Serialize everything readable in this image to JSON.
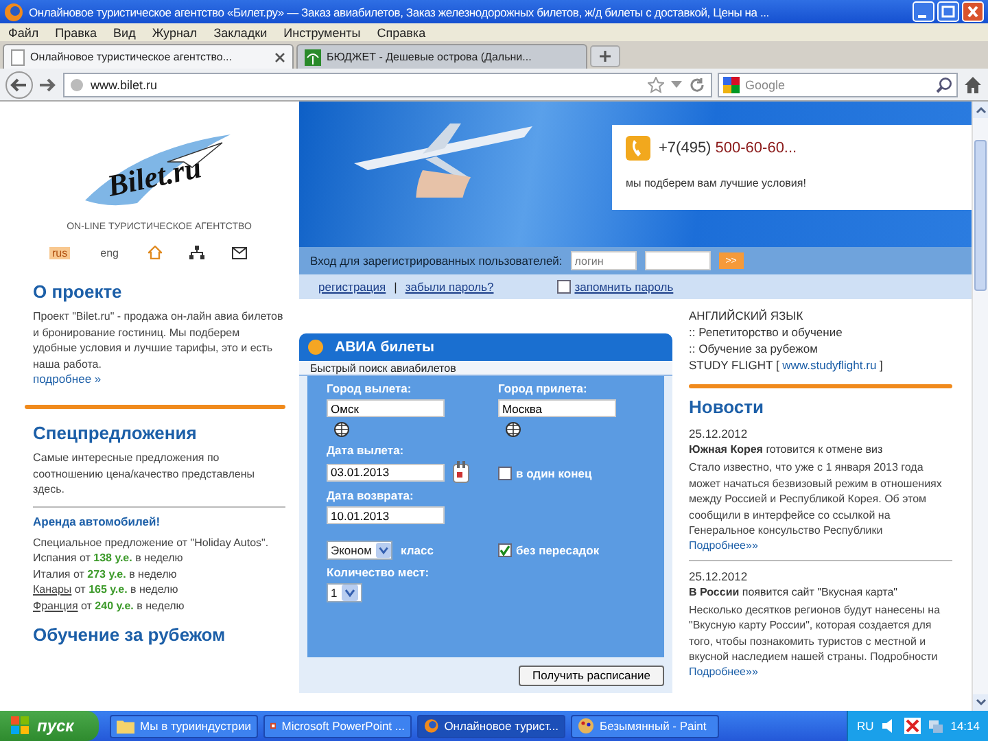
{
  "window": {
    "title": "Онлайновое туристическое агентство «Билет.ру» — Заказ авиабилетов, Заказ железнодорожных билетов, ж/д билеты с доставкой, Цены на ..."
  },
  "menu": [
    "Файл",
    "Правка",
    "Вид",
    "Журнал",
    "Закладки",
    "Инструменты",
    "Справка"
  ],
  "tabs": [
    {
      "label": "Онлайновое туристическое агентство...",
      "selected": true
    },
    {
      "label": "БЮДЖЕТ - Дешевые острова (Дальни...",
      "selected": false
    }
  ],
  "address_bar": {
    "url": "www.bilet.ru"
  },
  "search": {
    "placeholder": "Google"
  },
  "site": {
    "logo": {
      "name": "Bilet.ru",
      "tagline": "ON-LINE ТУРИСТИЧЕСКОЕ АГЕНТСТВО"
    },
    "toolbar": [
      {
        "kind": "lang",
        "label": "rus",
        "selected": true
      },
      {
        "kind": "lang",
        "label": "eng",
        "selected": false
      },
      {
        "kind": "home"
      },
      {
        "kind": "sitemap"
      },
      {
        "kind": "mail"
      }
    ],
    "banner": {
      "phone_prefix": "+7(495)",
      "phone_number": "500-60-60...",
      "slogan": "мы подберем вам лучшие условия!"
    },
    "login": {
      "label": "Вход для зарегистрированных пользователей:",
      "username_placeholder": "логин",
      "submit": ">>",
      "register": "регистрация",
      "separator": "|",
      "forgot": "забыли пароль?",
      "remember": {
        "label": "запомнить пароль",
        "checked": false
      }
    },
    "about": {
      "title": "О проекте",
      "text": "Проект \"Bilet.ru\" - продажа он-лайн авиа билетов и бронирование гостиниц. Мы подберем удобные условия и лучшие тарифы, это и есть наша работа.",
      "more": "подробнее »"
    },
    "specials": {
      "title": "Спецпредложения",
      "text": "Самые интересные предложения по соотношению цена/качество представлены здесь.",
      "offer_title": "Аренда автомобилей!",
      "offer_text": "Специальное предложение от \"Holiday Autos\".",
      "offers": [
        {
          "place": "Испания",
          "link": false,
          "from": "от",
          "price": "138 у.е.",
          "period": "в неделю"
        },
        {
          "place": "Италия",
          "link": false,
          "from": "от",
          "price": "273 у.е.",
          "period": "в неделю"
        },
        {
          "place": "Канары",
          "link": true,
          "from": "от",
          "price": "165 у.е.",
          "period": "в неделю"
        },
        {
          "place": "Франция",
          "link": true,
          "from": "от",
          "price": "240 у.е.",
          "period": "в неделю"
        }
      ]
    },
    "study_title": "Обучение за рубежом",
    "search_form": {
      "title": "АВИА билеты",
      "subtitle": "Быстрый поиск авиабилетов",
      "from": {
        "label": "Город вылета:",
        "value": "Омск"
      },
      "to": {
        "label": "Город прилета:",
        "value": "Москва"
      },
      "depart": {
        "label": "Дата вылета:",
        "value": "03.01.2013"
      },
      "one_way": {
        "label": "в один конец",
        "checked": false
      },
      "return": {
        "label": "Дата возврата:",
        "value": "10.01.2013"
      },
      "class": {
        "value": "Эконом",
        "label": "класс"
      },
      "direct": {
        "label": "без пересадок",
        "checked": true
      },
      "seats": {
        "label": "Количество мест:",
        "value": "1"
      },
      "submit": "Получить расписание"
    },
    "courses": {
      "title": "АНГЛИЙСКИЙ ЯЗЫК",
      "items": [
        ":: Репетиторство и обучение",
        ":: Обучение за рубежом"
      ],
      "source": "STUDY FLIGHT [",
      "link": "www.studyflight.ru",
      "source_end": "]"
    },
    "news": {
      "title": "Новости",
      "items": [
        {
          "date": "25.12.2012",
          "headline": "**Южная Корея** готовится к отмене виз",
          "text": "Стало известно, что уже с 1 января 2013 года может начаться безвизовый режим в отношениях между Россией и Республикой Корея. Об этом сообщили в интерфейсе со ссылкой на Генеральное консульство Республики",
          "more": "Подробнее»»"
        },
        {
          "date": "25.12.2012",
          "headline": "**В России** появится сайт \"Вкусная карта\"",
          "text": "Несколько десятков регионов будут нанесены на \"Вкусную карту России\", которая создается для того, чтобы познакомить туристов с местной и вкусной наследием нашей страны. Подробности",
          "more": "Подробнее»»"
        }
      ]
    }
  },
  "taskbar": {
    "start": "пуск",
    "tasks": [
      {
        "kind": "folder",
        "label": "Мы в турииндустрии",
        "selected": false
      },
      {
        "kind": "powerpoint",
        "label": "Microsoft PowerPoint ...",
        "selected": false
      },
      {
        "kind": "browser",
        "label": "Онлайновое турист...",
        "selected": true
      },
      {
        "kind": "paint",
        "label": "Безымянный - Paint",
        "selected": false
      }
    ],
    "language": "RU",
    "clock": "14:14"
  }
}
